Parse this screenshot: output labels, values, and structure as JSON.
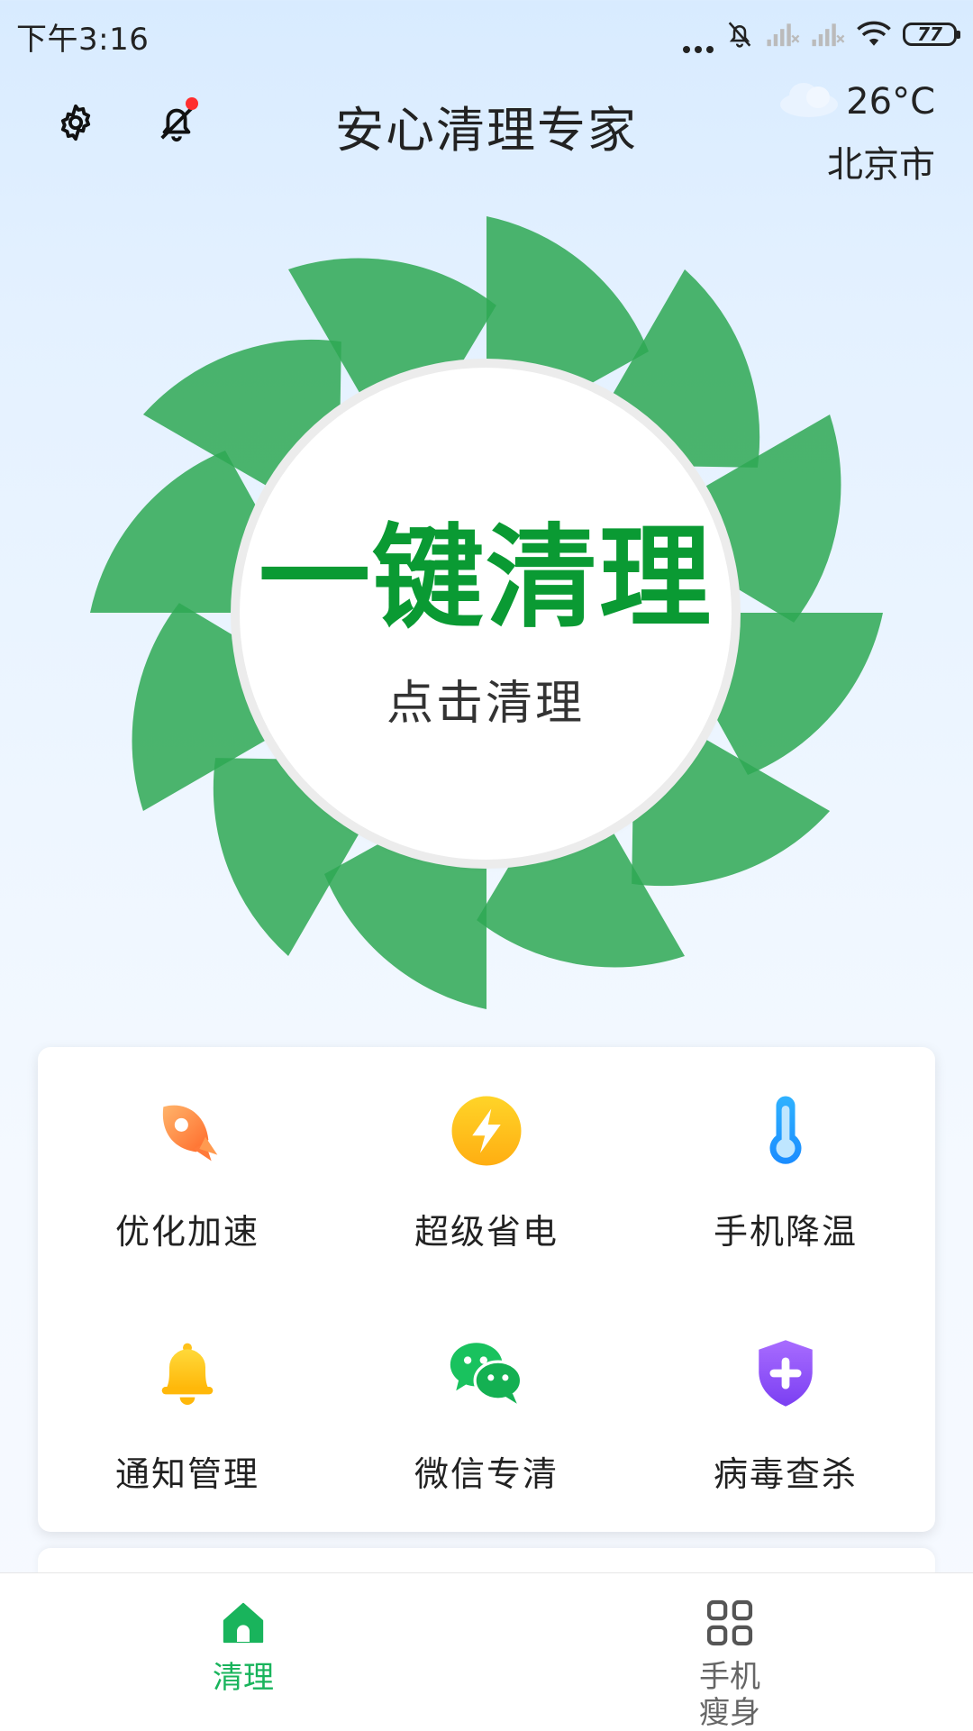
{
  "status_bar": {
    "time": "下午3:16",
    "battery": "77"
  },
  "header": {
    "title": "安心清理专家",
    "weather": {
      "temperature": "26°C",
      "city": "北京市",
      "icon": "cloud-icon"
    }
  },
  "clean_button": {
    "title": "一键清理",
    "subtitle": "点击清理"
  },
  "features": [
    {
      "label": "优化加速",
      "icon": "rocket-icon"
    },
    {
      "label": "超级省电",
      "icon": "lightning-icon"
    },
    {
      "label": "手机降温",
      "icon": "thermometer-icon"
    },
    {
      "label": "通知管理",
      "icon": "bell-icon"
    },
    {
      "label": "微信专清",
      "icon": "wechat-icon"
    },
    {
      "label": "病毒查杀",
      "icon": "shield-plus-icon"
    }
  ],
  "bottom_nav": {
    "items": [
      {
        "label": "清理",
        "icon": "home-icon",
        "active": true
      },
      {
        "label": "手机瘦身",
        "icon": "apps-grid-icon",
        "active": false
      }
    ]
  },
  "colors": {
    "primary_green": "#0a9a33",
    "fan_green": "#2ea854",
    "nav_active": "#19b45c"
  }
}
